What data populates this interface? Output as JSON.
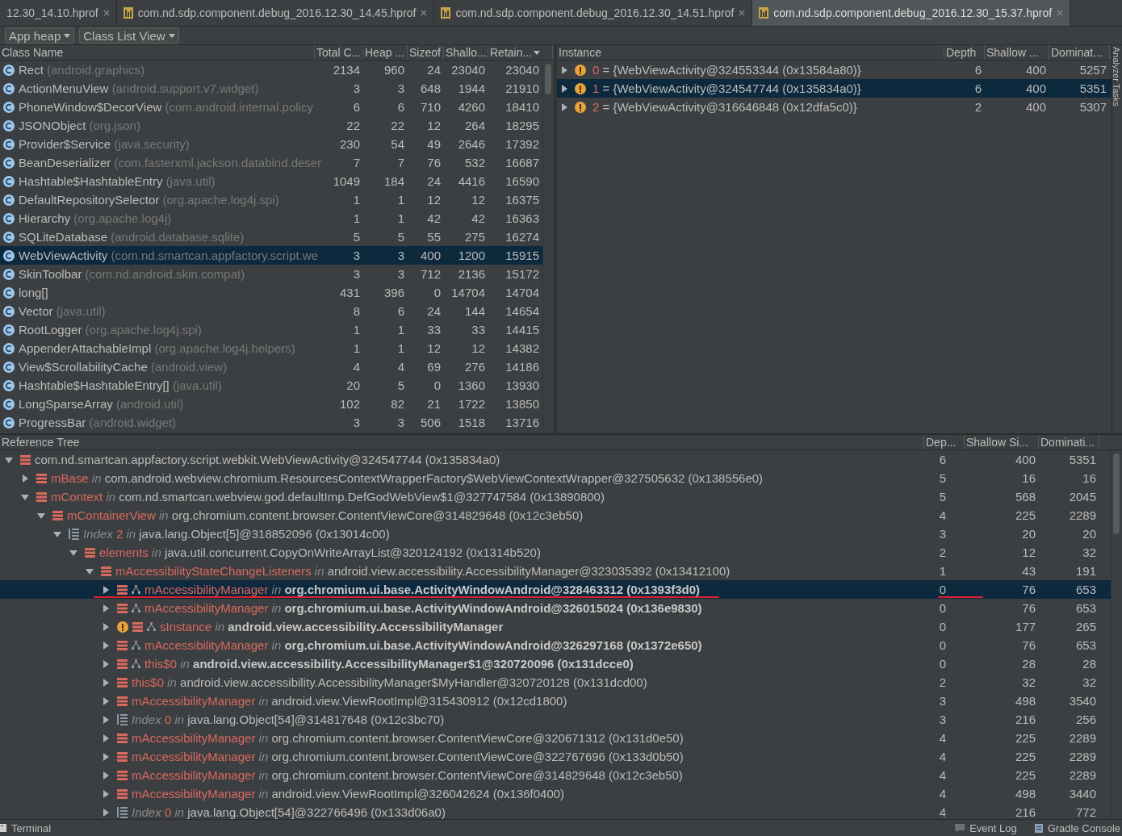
{
  "tabs": [
    {
      "label": "12.30_14.10.hprof",
      "icon": false,
      "selected": false
    },
    {
      "label": "com.nd.sdp.component.debug_2016.12.30_14.45.hprof",
      "icon": true,
      "selected": false
    },
    {
      "label": "com.nd.sdp.component.debug_2016.12.30_14.51.hprof",
      "icon": true,
      "selected": false
    },
    {
      "label": "com.nd.sdp.component.debug_2016.12.30_15.37.hprof",
      "icon": true,
      "selected": true
    }
  ],
  "toolbar": {
    "dropdowns": [
      "App heap",
      "Class List View"
    ]
  },
  "class_table": {
    "columns": [
      "Class Name",
      "Total C...",
      "Heap ...",
      "Sizeof",
      "Shallo...",
      "Retain..."
    ],
    "rows": [
      {
        "name": "Rect",
        "package": "(android.graphics)",
        "values": [
          "2134",
          "960",
          "24",
          "23040",
          "23040"
        ],
        "selected": false
      },
      {
        "name": "ActionMenuView",
        "package": "(android.support.v7.widget)",
        "values": [
          "3",
          "3",
          "648",
          "1944",
          "21910"
        ],
        "selected": false
      },
      {
        "name": "PhoneWindow$DecorView",
        "package": "(com.android.internal.policy",
        "values": [
          "6",
          "6",
          "710",
          "4260",
          "18410"
        ],
        "selected": false
      },
      {
        "name": "JSONObject",
        "package": "(org.json)",
        "values": [
          "22",
          "22",
          "12",
          "264",
          "18295"
        ],
        "selected": false
      },
      {
        "name": "Provider$Service",
        "package": "(java.security)",
        "values": [
          "230",
          "54",
          "49",
          "2646",
          "17392"
        ],
        "selected": false
      },
      {
        "name": "BeanDeserializer",
        "package": "(com.fasterxml.jackson.databind.deser",
        "values": [
          "7",
          "7",
          "76",
          "532",
          "16687"
        ],
        "selected": false
      },
      {
        "name": "Hashtable$HashtableEntry",
        "package": "(java.util)",
        "values": [
          "1049",
          "184",
          "24",
          "4416",
          "16590"
        ],
        "selected": false
      },
      {
        "name": "DefaultRepositorySelector",
        "package": "(org.apache.log4j.spi)",
        "values": [
          "1",
          "1",
          "12",
          "12",
          "16375"
        ],
        "selected": false
      },
      {
        "name": "Hierarchy",
        "package": "(org.apache.log4j)",
        "values": [
          "1",
          "1",
          "42",
          "42",
          "16363"
        ],
        "selected": false
      },
      {
        "name": "SQLiteDatabase",
        "package": "(android.database.sqlite)",
        "values": [
          "5",
          "5",
          "55",
          "275",
          "16274"
        ],
        "selected": false
      },
      {
        "name": "WebViewActivity",
        "package": "(com.nd.smartcan.appfactory.script.we",
        "values": [
          "3",
          "3",
          "400",
          "1200",
          "15915"
        ],
        "selected": true
      },
      {
        "name": "SkinToolbar",
        "package": "(com.nd.android.skin.compat)",
        "values": [
          "3",
          "3",
          "712",
          "2136",
          "15172"
        ],
        "selected": false
      },
      {
        "name": "long[]",
        "values": [
          "431",
          "396",
          "0",
          "14704",
          "14704"
        ],
        "selected": false
      },
      {
        "name": "Vector",
        "package": "(java.util)",
        "values": [
          "8",
          "6",
          "24",
          "144",
          "14654"
        ],
        "selected": false
      },
      {
        "name": "RootLogger",
        "package": "(org.apache.log4j.spi)",
        "values": [
          "1",
          "1",
          "33",
          "33",
          "14415"
        ],
        "selected": false
      },
      {
        "name": "AppenderAttachableImpl",
        "package": "(org.apache.log4j.helpers)",
        "values": [
          "1",
          "1",
          "12",
          "12",
          "14382"
        ],
        "selected": false
      },
      {
        "name": "View$ScrollabilityCache",
        "package": "(android.view)",
        "values": [
          "4",
          "4",
          "69",
          "276",
          "14186"
        ],
        "selected": false
      },
      {
        "name": "Hashtable$HashtableEntry[]",
        "package": "(java.util)",
        "values": [
          "20",
          "5",
          "0",
          "1360",
          "13930"
        ],
        "selected": false
      },
      {
        "name": "LongSparseArray",
        "package": "(android.util)",
        "values": [
          "102",
          "82",
          "21",
          "1722",
          "13850"
        ],
        "selected": false
      },
      {
        "name": "ProgressBar",
        "package": "(android.widget)",
        "values": [
          "3",
          "3",
          "506",
          "1518",
          "13716"
        ],
        "selected": false
      }
    ]
  },
  "instance_table": {
    "columns": [
      "Instance",
      "Depth",
      "Shallow ...",
      "Dominat..."
    ],
    "rows": [
      {
        "index": "0",
        "value": "= {WebViewActivity@324553344 (0x13584a80)}",
        "depth": "6",
        "shallow": "400",
        "dominating": "5257",
        "selected": false
      },
      {
        "index": "1",
        "value": "= {WebViewActivity@324547744 (0x135834a0)}",
        "depth": "6",
        "shallow": "400",
        "dominating": "5351",
        "selected": true
      },
      {
        "index": "2",
        "value": "= {WebViewActivity@316646848 (0x12dfa5c0)}",
        "depth": "2",
        "shallow": "400",
        "dominating": "5307",
        "selected": false
      }
    ]
  },
  "side_strip": {
    "label": "Analyzer Tasks"
  },
  "reference_tree": {
    "columns": [
      "Reference Tree",
      "Dep...",
      "Shallow Si...",
      "Dominati..."
    ],
    "rows": [
      {
        "kind": "field",
        "name": "com.nd.smartcan.appfactory.script.webkit.WebViewActivity@324547744 (0x135834a0)",
        "selected": false,
        "expanded": true,
        "depth": "6",
        "shallow": "400",
        "dominating": "5351",
        "children": [
          {
            "kind": "field",
            "name": "mBase",
            "selected": false,
            "in": "in",
            "target": "com.android.webview.chromium.ResourcesContextWrapperFactory$WebViewContextWrapper@327505632 (0x138556e0)",
            "expanded": false,
            "depth": "5",
            "shallow": "16",
            "dominating": "16"
          },
          {
            "kind": "field",
            "name": "mContext",
            "selected": false,
            "in": "in",
            "target": "com.nd.smartcan.webview.god.defaultImp.DefGodWebView$1@327747584 (0x13890800)",
            "expanded": true,
            "depth": "5",
            "shallow": "568",
            "dominating": "2045",
            "children": [
              {
                "kind": "field",
                "name": "mContainerView",
                "selected": false,
                "in": "in",
                "target": "org.chromium.content.browser.ContentViewCore@314829648 (0x12c3eb50)",
                "expanded": true,
                "depth": "4",
                "shallow": "225",
                "dominating": "2289",
                "children": [
                  {
                    "kind": "array",
                    "name": "Index",
                    "index": "2",
                    "selected": false,
                    "in": "in",
                    "target": "java.lang.Object[5]@318852096 (0x13014c00)",
                    "expanded": true,
                    "depth": "3",
                    "shallow": "20",
                    "dominating": "20",
                    "children": [
                      {
                        "kind": "field",
                        "name": "elements",
                        "selected": false,
                        "in": "in",
                        "target": "java.util.concurrent.CopyOnWriteArrayList@320124192 (0x1314b520)",
                        "expanded": true,
                        "depth": "2",
                        "shallow": "12",
                        "dominating": "32",
                        "children": [
                          {
                            "kind": "field",
                            "name": "mAccessibilityStateChangeListeners",
                            "selected": false,
                            "in": "in",
                            "target": "android.view.accessibility.AccessibilityManager@323035392 (0x13412100)",
                            "expanded": true,
                            "depth": "1",
                            "shallow": "43",
                            "dominating": "191",
                            "children": [
                              {
                                "kind": "field",
                                "gc_root": true,
                                "bold": true,
                                "selected": true,
                                "underlined": true,
                                "name": "mAccessibilityManager",
                                "in": "in",
                                "target": "org.chromium.ui.base.ActivityWindowAndroid@328463312 (0x1393f3d0)",
                                "expanded": false,
                                "depth": "0",
                                "shallow": "76",
                                "dominating": "653"
                              },
                              {
                                "kind": "field",
                                "gc_root": true,
                                "bold": true,
                                "selected": false,
                                "name": "mAccessibilityManager",
                                "in": "in",
                                "target": "org.chromium.ui.base.ActivityWindowAndroid@326015024 (0x136e9830)",
                                "expanded": false,
                                "depth": "0",
                                "shallow": "76",
                                "dominating": "653"
                              },
                              {
                                "kind": "static",
                                "gc_root": true,
                                "bold": true,
                                "selected": false,
                                "name": "sInstance",
                                "in": "in",
                                "target": "android.view.accessibility.AccessibilityManager",
                                "expanded": false,
                                "depth": "0",
                                "shallow": "177",
                                "dominating": "265"
                              },
                              {
                                "kind": "field",
                                "gc_root": true,
                                "bold": true,
                                "selected": false,
                                "name": "mAccessibilityManager",
                                "in": "in",
                                "target": "org.chromium.ui.base.ActivityWindowAndroid@326297168 (0x1372e650)",
                                "expanded": false,
                                "depth": "0",
                                "shallow": "76",
                                "dominating": "653"
                              },
                              {
                                "kind": "field",
                                "gc_root": true,
                                "bold": true,
                                "selected": false,
                                "name": "this$0",
                                "in": "in",
                                "target": "android.view.accessibility.AccessibilityManager$1@320720096 (0x131dcce0)",
                                "expanded": false,
                                "depth": "0",
                                "shallow": "28",
                                "dominating": "28"
                              },
                              {
                                "kind": "field",
                                "name": "this$0",
                                "selected": false,
                                "in": "in",
                                "target": "android.view.accessibility.AccessibilityManager$MyHandler@320720128 (0x131dcd00)",
                                "expanded": false,
                                "depth": "2",
                                "shallow": "32",
                                "dominating": "32"
                              },
                              {
                                "kind": "field",
                                "name": "mAccessibilityManager",
                                "in": "in",
                                "target": "android.view.ViewRootImpl@315430912 (0x12cd1800)",
                                "selected": false,
                                "expanded": false,
                                "depth": "3",
                                "shallow": "498",
                                "dominating": "3540"
                              },
                              {
                                "kind": "array",
                                "name": "Index",
                                "index": "0",
                                "in": "in",
                                "target": "java.lang.Object[54]@314817648 (0x12c3bc70)",
                                "selected": false,
                                "expanded": false,
                                "depth": "3",
                                "shallow": "216",
                                "dominating": "256"
                              },
                              {
                                "kind": "field",
                                "name": "mAccessibilityManager",
                                "in": "in",
                                "target": "org.chromium.content.browser.ContentViewCore@320671312 (0x131d0e50)",
                                "selected": false,
                                "expanded": false,
                                "depth": "4",
                                "shallow": "225",
                                "dominating": "2289"
                              },
                              {
                                "kind": "field",
                                "name": "mAccessibilityManager",
                                "in": "in",
                                "target": "org.chromium.content.browser.ContentViewCore@322767696 (0x133d0b50)",
                                "selected": false,
                                "expanded": false,
                                "depth": "4",
                                "shallow": "225",
                                "dominating": "2289"
                              },
                              {
                                "kind": "field",
                                "name": "mAccessibilityManager",
                                "in": "in",
                                "target": "org.chromium.content.browser.ContentViewCore@314829648 (0x12c3eb50)",
                                "selected": false,
                                "expanded": false,
                                "depth": "4",
                                "shallow": "225",
                                "dominating": "2289"
                              },
                              {
                                "kind": "field",
                                "name": "mAccessibilityManager",
                                "in": "in",
                                "target": "android.view.ViewRootImpl@326042624 (0x136f0400)",
                                "selected": false,
                                "expanded": false,
                                "depth": "4",
                                "shallow": "498",
                                "dominating": "3440"
                              },
                              {
                                "kind": "array",
                                "name": "Index",
                                "index": "0",
                                "in": "in",
                                "target": "java.lang.Object[54]@322766496 (0x133d06a0)",
                                "selected": false,
                                "expanded": false,
                                "depth": "4",
                                "shallow": "216",
                                "dominating": "772"
                              }
                            ]
                          }
                        ]
                      }
                    ]
                  }
                ]
              }
            ]
          }
        ]
      }
    ]
  },
  "status_bar": {
    "left": [
      "Terminal"
    ],
    "right": [
      "Event Log",
      "Gradle Console"
    ]
  }
}
